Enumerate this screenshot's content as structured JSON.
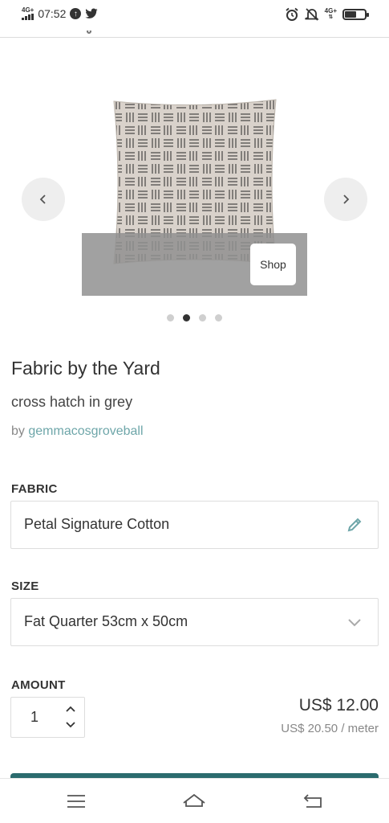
{
  "status_bar": {
    "network_badge": "4G+",
    "time": "07:52",
    "right_network_badge": "4G+",
    "battery_level": 0.6
  },
  "product": {
    "category_title": "Fabric by the Yard",
    "design_name": "cross hatch in grey",
    "by_label": "by",
    "designer": "gemmacosgroveball"
  },
  "gallery": {
    "shop_label": "Shop",
    "slide_count": 4,
    "active_slide": 1
  },
  "fabric": {
    "label": "FABRIC",
    "value": "Petal Signature Cotton"
  },
  "size": {
    "label": "SIZE",
    "value": "Fat Quarter 53cm x 50cm"
  },
  "amount": {
    "label": "AMOUNT",
    "quantity": "1"
  },
  "pricing": {
    "price": "US$ 12.00",
    "unit_price": "US$ 20.50 / meter"
  },
  "colors": {
    "accent_teal": "#6ea6a9",
    "cart_button": "#2b6b6e"
  }
}
